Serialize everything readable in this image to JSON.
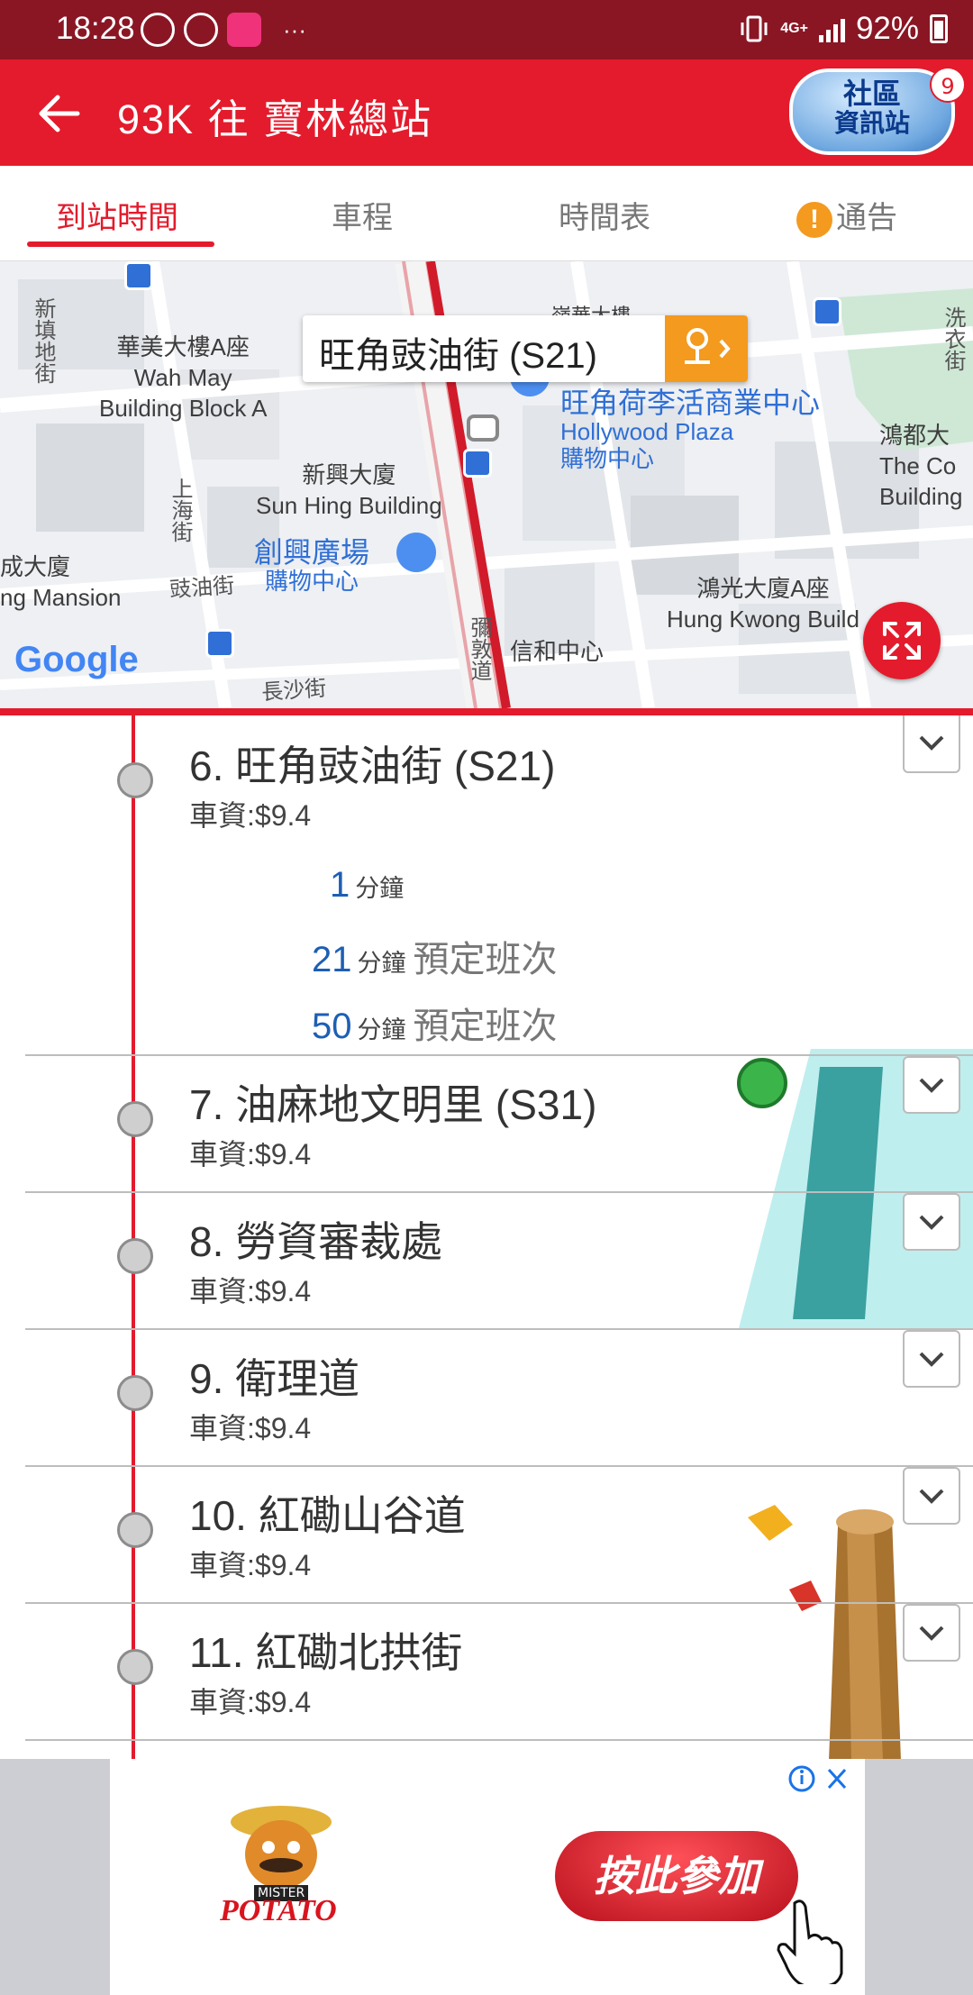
{
  "status_bar": {
    "time": "18:28",
    "overflow": "···",
    "network_small": "4G+",
    "network_small2": "4G",
    "battery_percent": "92%"
  },
  "app_bar": {
    "title": "93K 往 寶林總站",
    "community_line1": "社區",
    "community_line2": "資訊站",
    "community_badge": "9"
  },
  "tabs": [
    {
      "label": "到站時間",
      "active": true
    },
    {
      "label": "車程",
      "active": false
    },
    {
      "label": "時間表",
      "active": false
    },
    {
      "label": "通告",
      "active": false
    }
  ],
  "map": {
    "callout_text": "旺角豉油街 (S21)",
    "labels": {
      "wah_may_zh": "華美大樓A座",
      "wah_may_en1": "Wah May",
      "wah_may_en2": "Building Block A",
      "sun_hing_zh": "新興大廈",
      "sun_hing_en": "Sun Hing Building",
      "hollywood_zh": "旺角荷李活商業中心",
      "hollywood_en": "Hollywood Plaza",
      "hollywood_sub": "購物中心",
      "chong_hing_zh": "創興廣場",
      "chong_hing_sub": "購物中心",
      "hung_kwong_zh": "鴻光大廈A座",
      "hung_kwong_en": "Hung Kwong Build",
      "tower_right_zh": "鴻都大",
      "tower_right_en1": "The Co",
      "tower_right_en2": "Building",
      "mansion_zh": "成大廈",
      "mansion_en": "ng Mansion",
      "shun_wo": "信和中心",
      "top_partial": "嶺華大樓"
    },
    "streets": {
      "sun_tin": "新填地街",
      "shanghai": "上海街",
      "soy": "豉油街",
      "cheung_sha": "長沙街",
      "nathan": "彌敦道",
      "sai_yee": "洗衣街"
    },
    "google": "Google"
  },
  "stops": [
    {
      "name": "6. 旺角豉油街 (S21)",
      "fare": "車資:$9.4"
    },
    {
      "name": "7. 油麻地文明里 (S31)",
      "fare": "車資:$9.4"
    },
    {
      "name": "8. 勞資審裁處",
      "fare": "車資:$9.4"
    },
    {
      "name": "9. 衛理道",
      "fare": "車資:$9.4"
    },
    {
      "name": "10. 紅磡山谷道",
      "fare": "車資:$9.4"
    },
    {
      "name": "11. 紅磡北拱街",
      "fare": "車資:$9.4"
    }
  ],
  "etas": [
    {
      "minutes": "1",
      "unit": "分鐘",
      "note": ""
    },
    {
      "minutes": "21",
      "unit": "分鐘",
      "note": "預定班次"
    },
    {
      "minutes": "50",
      "unit": "分鐘",
      "note": "預定班次"
    }
  ],
  "ad": {
    "button": "按此參加",
    "brand": "POTATO",
    "brand_top": "MISTER"
  },
  "colors": {
    "primary": "#e31b2c",
    "status_bar": "#8a1624",
    "eta_blue": "#1d5fb3",
    "accent_orange": "#f39a1f"
  }
}
